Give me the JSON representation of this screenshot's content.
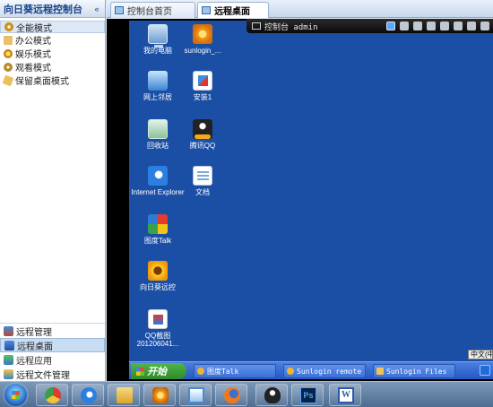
{
  "left_panel": {
    "title": "向日葵远程控制台",
    "modes": [
      {
        "label": "全能模式",
        "icon": "gear-icon"
      },
      {
        "label": "办公模式",
        "icon": "briefcase-icon"
      },
      {
        "label": "娱乐模式",
        "icon": "sun-icon"
      },
      {
        "label": "观看模式",
        "icon": "eye-icon"
      },
      {
        "label": "保留桌面模式",
        "icon": "pin-icon"
      }
    ],
    "selected_mode": "全能模式",
    "nav": [
      {
        "label": "远程管理",
        "icon": "remote-manage-icon"
      },
      {
        "label": "远程桌面",
        "icon": "remote-desktop-icon"
      },
      {
        "label": "远程应用",
        "icon": "remote-app-icon"
      },
      {
        "label": "远程文件管理",
        "icon": "remote-file-icon"
      }
    ],
    "selected_nav": "远程桌面"
  },
  "tabs": [
    {
      "label": "控制台首页",
      "active": false
    },
    {
      "label": "远程桌面",
      "active": true
    }
  ],
  "remote_toolbar": {
    "label": "控制台 admin",
    "buttons": [
      "screen-icon",
      "gear-icon",
      "tag-icon",
      "camera-icon",
      "plus-icon",
      "fullscreen-icon",
      "hand-icon",
      "close-icon"
    ]
  },
  "desktop_icons": [
    {
      "label": "我的电脑",
      "icon": "computer-icon"
    },
    {
      "label": "sunlogin_...",
      "icon": "sunlogin-icon"
    },
    {
      "label": "网上邻居",
      "icon": "network-icon"
    },
    {
      "label": "安装1",
      "icon": "installer-icon"
    },
    {
      "label": "回收站",
      "icon": "recycle-bin-icon"
    },
    {
      "label": "腾讯QQ",
      "icon": "qq-icon"
    },
    {
      "label": "Internet Explorer",
      "icon": "ie-icon"
    },
    {
      "label": "文档",
      "icon": "document-icon"
    },
    {
      "label": "图度Talk",
      "icon": "talk-icon"
    },
    {
      "label": "向日葵远控",
      "icon": "sunflower-icon"
    },
    {
      "label": "QQ截图 201206041...",
      "icon": "screenshot-icon"
    }
  ],
  "remote_taskbar": {
    "start_label": "开始",
    "tasks": [
      "图度Talk",
      "Sunlogin remote",
      "Sunlogin Files"
    ],
    "ime_label": "中文(中"
  },
  "win_taskbar": {
    "pinned": [
      "chrome-icon",
      "ie-icon",
      "folder-icon",
      "sunlogin-icon",
      "window-icon",
      "firefox-icon",
      "qq-icon",
      "photoshop-icon",
      "word-icon"
    ],
    "ps_label": "Ps",
    "word_label": "W"
  }
}
